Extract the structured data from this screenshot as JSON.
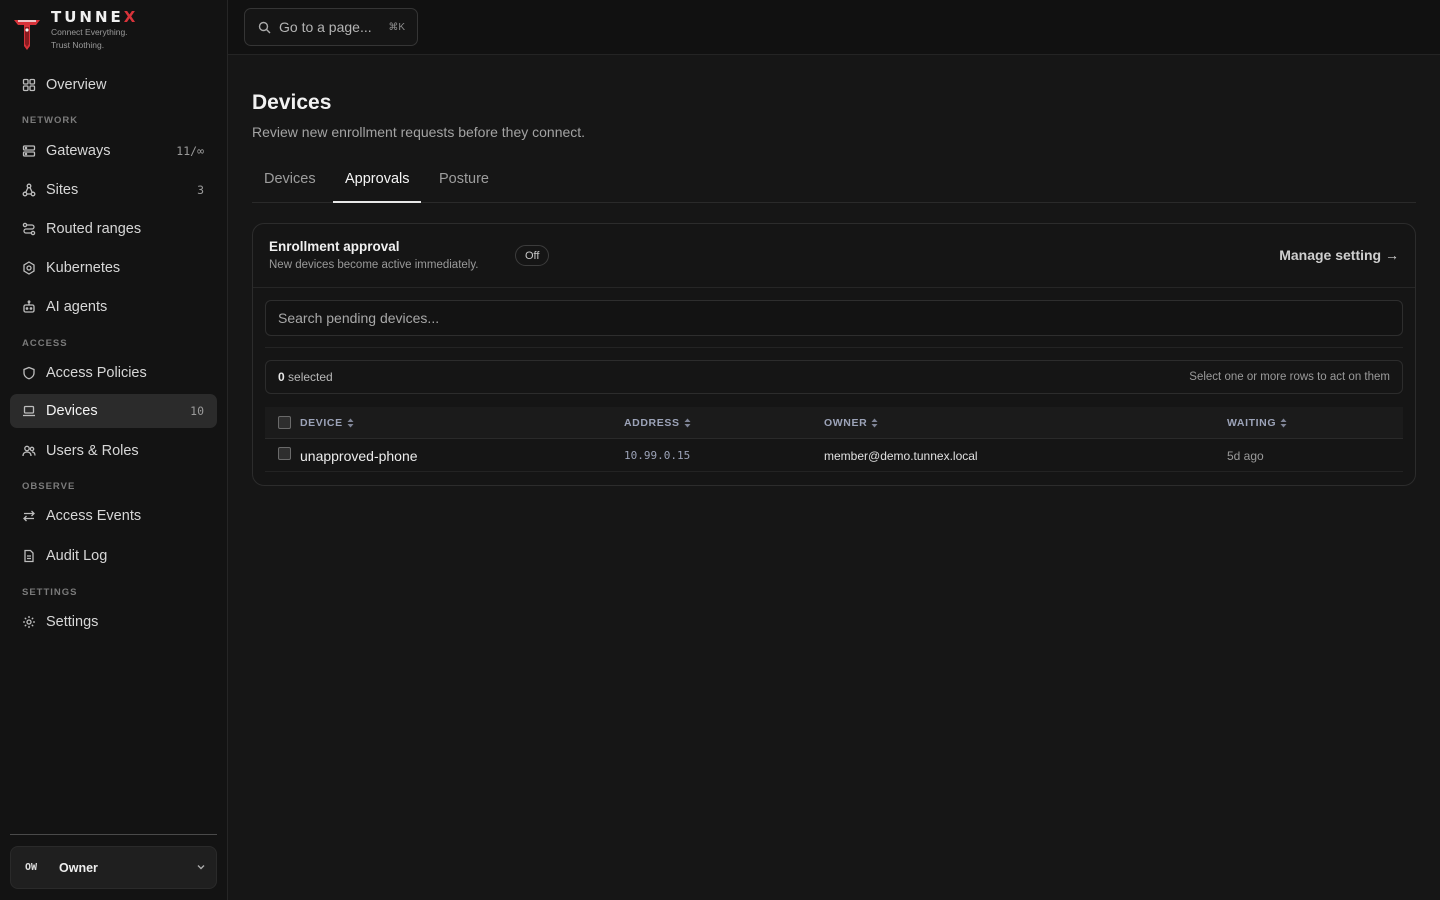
{
  "brand": {
    "name_prefix": "TUNNE",
    "name_suffix": "X",
    "tagline_1": "Connect Everything.",
    "tagline_2": "Trust Nothing.",
    "accent": "#d8333a"
  },
  "sidebar": {
    "overview": {
      "label": "Overview",
      "icon": "grid-icon"
    },
    "sections": {
      "network": "NETWORK",
      "access": "ACCESS",
      "observe": "OBSERVE",
      "settings": "SETTINGS"
    },
    "items": {
      "gateways": {
        "label": "Gateways",
        "count": "11/∞",
        "icon": "server-icon"
      },
      "sites": {
        "label": "Sites",
        "count": "3",
        "icon": "sites-icon"
      },
      "routed_ranges": {
        "label": "Routed ranges",
        "icon": "route-icon"
      },
      "kubernetes": {
        "label": "Kubernetes",
        "icon": "kubernetes-icon"
      },
      "ai_agents": {
        "label": "AI agents",
        "icon": "robot-icon"
      },
      "access_policies": {
        "label": "Access Policies",
        "icon": "shield-icon"
      },
      "devices": {
        "label": "Devices",
        "count": "10",
        "icon": "laptop-icon"
      },
      "users_roles": {
        "label": "Users & Roles",
        "icon": "users-icon"
      },
      "access_events": {
        "label": "Access Events",
        "icon": "arrows-icon"
      },
      "audit_log": {
        "label": "Audit Log",
        "icon": "file-icon"
      },
      "settings": {
        "label": "Settings",
        "icon": "gear-icon"
      }
    },
    "user": {
      "initials": "OW",
      "name": "Owner"
    }
  },
  "topbar": {
    "search_label": "Go to a page...",
    "shortcut": "⌘K"
  },
  "page": {
    "title": "Devices",
    "subtitle": "Review new enrollment requests before they connect.",
    "tabs": [
      {
        "label": "Devices",
        "active": false
      },
      {
        "label": "Approvals",
        "active": true
      },
      {
        "label": "Posture",
        "active": false
      }
    ]
  },
  "approval": {
    "title": "Enrollment approval",
    "description": "New devices become active immediately.",
    "status": "Off",
    "manage_label": "Manage setting →",
    "search_placeholder": "Search pending devices...",
    "selected_count": "0",
    "selected_suffix": " selected",
    "selection_hint": "Select one or more rows to act on them",
    "columns": [
      "DEVICE",
      "ADDRESS",
      "OWNER",
      "WAITING"
    ],
    "rows": [
      {
        "device": "unapproved-phone",
        "address": "10.99.0.15",
        "owner": "member@demo.tunnex.local",
        "waiting": "5d ago"
      }
    ]
  }
}
